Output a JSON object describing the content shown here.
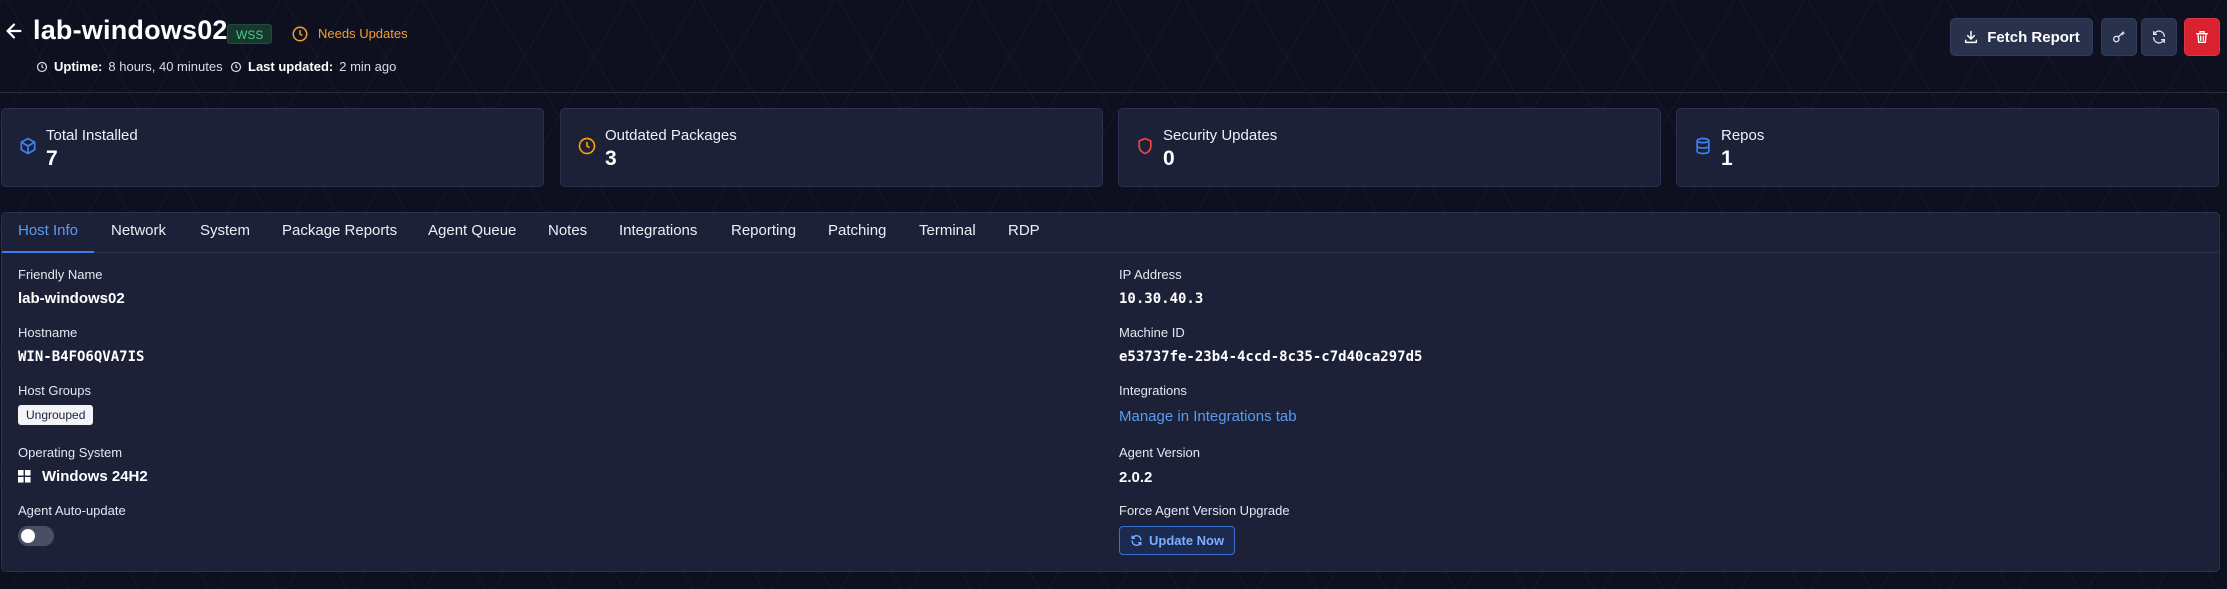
{
  "header": {
    "title": "lab-windows02",
    "badge": "WSS",
    "status": "Needs Updates",
    "uptime_label": "Uptime:",
    "uptime_value": "8 hours, 40 minutes",
    "updated_label": "Last updated:",
    "updated_value": "2 min ago",
    "fetch_label": "Fetch Report"
  },
  "stats": [
    {
      "label": "Total Installed",
      "value": "7",
      "icon": "box-icon",
      "color": "#3b82f6"
    },
    {
      "label": "Outdated Packages",
      "value": "3",
      "icon": "clock-icon",
      "color": "#f59e0b"
    },
    {
      "label": "Security Updates",
      "value": "0",
      "icon": "shield-icon",
      "color": "#ef4444"
    },
    {
      "label": "Repos",
      "value": "1",
      "icon": "database-icon",
      "color": "#3b82f6"
    }
  ],
  "tabs": [
    "Host Info",
    "Network",
    "System",
    "Package Reports",
    "Agent Queue",
    "Notes",
    "Integrations",
    "Reporting",
    "Patching",
    "Terminal",
    "RDP"
  ],
  "active_tab": "Host Info",
  "host_info": {
    "friendly_name_label": "Friendly Name",
    "friendly_name": "lab-windows02",
    "hostname_label": "Hostname",
    "hostname": "WIN-B4FO6QVA7IS",
    "host_groups_label": "Host Groups",
    "host_group": "Ungrouped",
    "os_label": "Operating System",
    "os": "Windows 24H2",
    "auto_update_label": "Agent Auto-update",
    "auto_update_enabled": false,
    "ip_label": "IP Address",
    "ip": "10.30.40.3",
    "machine_id_label": "Machine ID",
    "machine_id": "e53737fe-23b4-4ccd-8c35-c7d40ca297d5",
    "integrations_label": "Integrations",
    "integrations_link": "Manage in Integrations tab",
    "agent_version_label": "Agent Version",
    "agent_version": "2.0.2",
    "force_upgrade_label": "Force Agent Version Upgrade",
    "update_now": "Update Now"
  }
}
